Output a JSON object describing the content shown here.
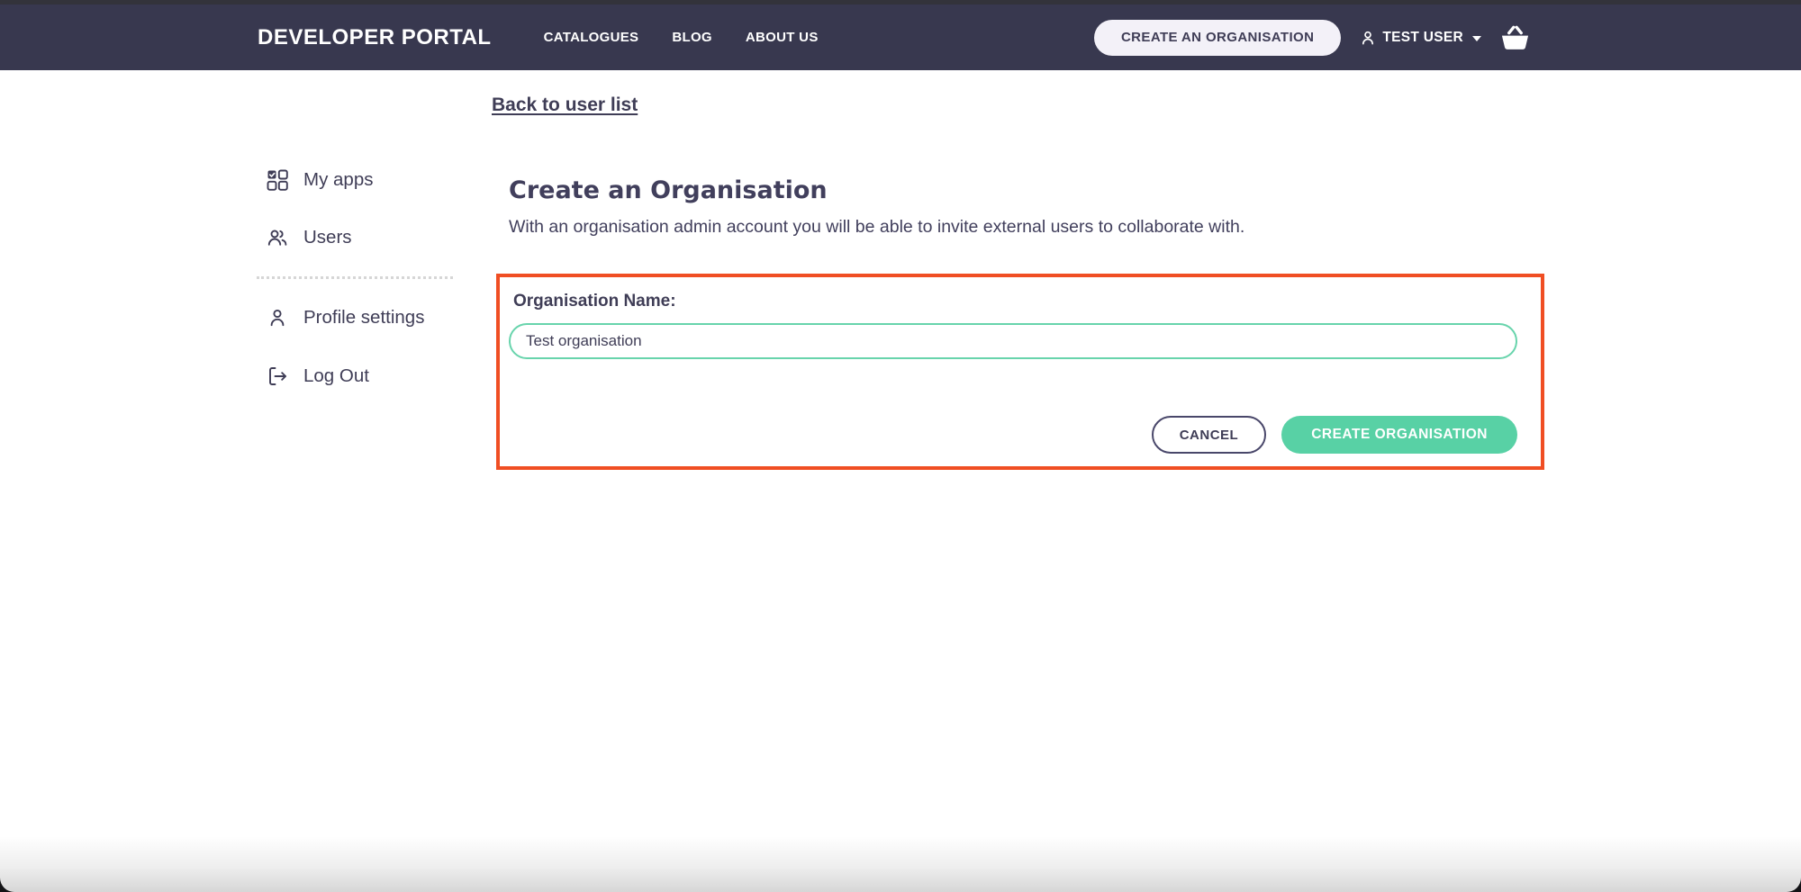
{
  "navbar": {
    "title": "DEVELOPER PORTAL",
    "links": [
      {
        "label": "CATALOGUES"
      },
      {
        "label": "BLOG"
      },
      {
        "label": "ABOUT US"
      }
    ],
    "create_org_button": "CREATE AN ORGANISATION",
    "user_menu": {
      "label": "TEST USER",
      "icons": [
        "person-icon",
        "chevron-down-icon"
      ]
    },
    "basket_icon": "basket-icon"
  },
  "back_link": {
    "label": "Back to user list"
  },
  "sidebar": {
    "items": [
      {
        "label": "My apps",
        "icon": "apps-grid-icon"
      },
      {
        "label": "Users",
        "icon": "users-icon"
      },
      {
        "label": "Profile settings",
        "icon": "person-icon"
      },
      {
        "label": "Log Out",
        "icon": "logout-icon"
      }
    ]
  },
  "main": {
    "heading": "Create an Organisation",
    "subtitle": "With an organisation admin account you will be able to invite external users to collaborate with.",
    "form": {
      "label": "Organisation Name:",
      "input_value": "Test organisation",
      "cancel_label": "CANCEL",
      "submit_label": "CREATE ORGANISATION"
    }
  },
  "colors": {
    "navbar_bg": "#38384f",
    "accent_teal": "#58d1a5",
    "input_border_teal": "#68d4ac",
    "highlight_red": "#f04e23",
    "text_dark": "#3f3d56",
    "pill_bg": "#f3f1f8"
  }
}
